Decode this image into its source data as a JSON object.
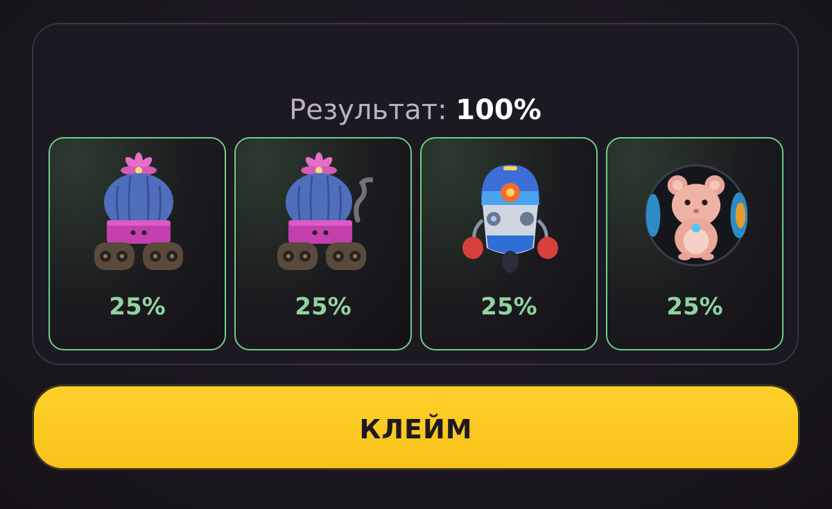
{
  "result": {
    "label": "Результат:",
    "value": "100%"
  },
  "cards": [
    {
      "icon": "cactus-robot-icon",
      "percent": "25%"
    },
    {
      "icon": "smoking-cactus-robot-icon",
      "percent": "25%"
    },
    {
      "icon": "boxing-robot-icon",
      "percent": "25%"
    },
    {
      "icon": "hamster-in-ball-icon",
      "percent": "25%"
    }
  ],
  "claim_button": {
    "label": "КЛЕЙМ"
  },
  "colors": {
    "accent_green": "#6fd08a",
    "percent_green": "#8fd3a0",
    "button_yellow": "#f8c219",
    "background": "#1c1820"
  }
}
